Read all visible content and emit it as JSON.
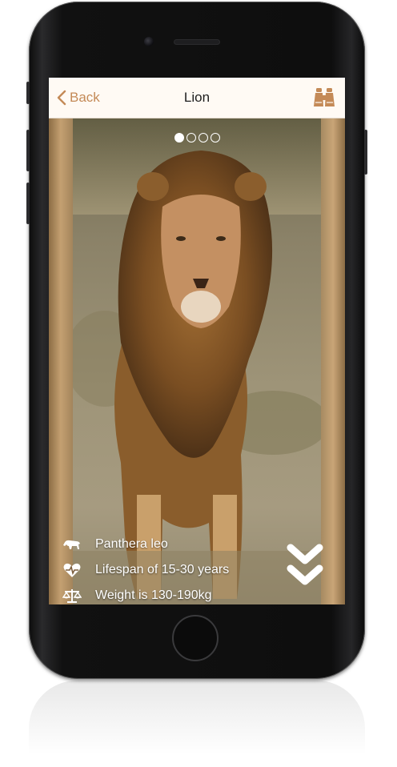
{
  "nav": {
    "back_label": "Back",
    "title": "Lion"
  },
  "carousel": {
    "page_count": 4,
    "active_index": 0
  },
  "facts": [
    {
      "icon": "lion-icon",
      "text": "Panthera leo"
    },
    {
      "icon": "heartbeat-icon",
      "text": "Lifespan of 15-30 years"
    },
    {
      "icon": "scale-icon",
      "text": "Weight is 130-190kg"
    }
  ],
  "colors": {
    "accent": "#c48a57",
    "navbar_bg": "#fffaf4",
    "title_text": "#1e1e1e"
  }
}
